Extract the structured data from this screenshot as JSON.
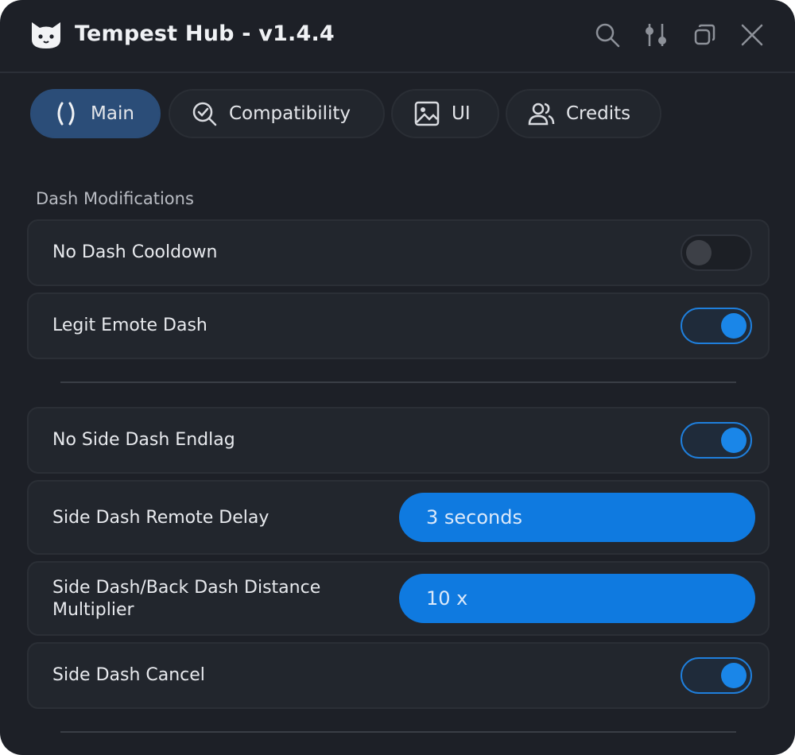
{
  "app": {
    "title": "Tempest Hub - v1.4.4"
  },
  "titlebar_icons": [
    "search-icon",
    "sliders-icon",
    "restore-icon",
    "close-icon"
  ],
  "tabs": [
    {
      "label": "Main",
      "icon": "code-brackets-icon",
      "active": true
    },
    {
      "label": "Compatibility",
      "icon": "check-search-icon",
      "active": false
    },
    {
      "label": "UI",
      "icon": "image-icon",
      "active": false
    },
    {
      "label": "Credits",
      "icon": "users-icon",
      "active": false
    }
  ],
  "sections": {
    "dash_modifications": "Dash Modifications"
  },
  "settings": {
    "no_dash_cooldown": {
      "label": "No Dash Cooldown",
      "enabled": false
    },
    "legit_emote_dash": {
      "label": "Legit Emote Dash",
      "enabled": true
    },
    "no_side_dash_endlag": {
      "label": "No Side Dash Endlag",
      "enabled": true
    },
    "side_dash_remote_delay": {
      "label": "Side Dash Remote Delay",
      "value": "3 seconds"
    },
    "distance_multiplier": {
      "label_line1": "Side Dash/Back Dash Distance",
      "label_line2": "Multiplier",
      "value": "10 x"
    },
    "side_dash_cancel": {
      "label": "Side Dash Cancel",
      "enabled": true
    }
  },
  "colors": {
    "background": "#1d2027",
    "accent": "#0f7ae0",
    "active_tab": "#2b4d78"
  }
}
